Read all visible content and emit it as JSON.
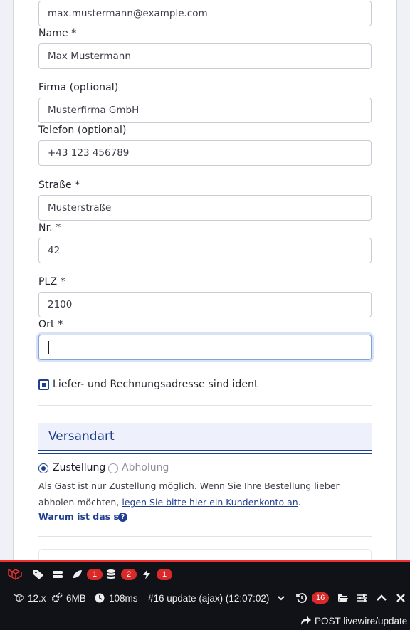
{
  "form": {
    "email_value": "max.mustermann@example.com",
    "name_label": "Name *",
    "name_value": "Max Mustermann",
    "company_label": "Firma (optional)",
    "company_value": "Musterfirma GmbH",
    "phone_label": "Telefon (optional)",
    "phone_value": "+43 123 456789",
    "street_label": "Straße *",
    "street_value": "Musterstraße",
    "number_label": "Nr. *",
    "number_value": "42",
    "zip_label": "PLZ *",
    "zip_value": "2100",
    "city_label": "Ort *",
    "city_value": "",
    "same_address_label": "Liefer- und Rechnungsadresse sind ident",
    "same_address_checked": true
  },
  "shipping": {
    "title": "Versandart",
    "option_delivery": "Zustellung",
    "option_pickup": "Abholung",
    "selected": "Zustellung",
    "info_text_1": "Als Gast ist nur Zustellung möglich. Wenn Sie Ihre Bestellung lieber abholen möchten,",
    "info_link": "legen Sie bitte hier ein Kundenkonto an",
    "info_text_2": ".",
    "why_label": "Warum ist das so",
    "why_icon": "?"
  },
  "debugbar": {
    "accent_color": "#f22d2d",
    "badge_color": "#d92a2a",
    "badges": {
      "queries": "1",
      "models": "2",
      "events": "1",
      "requests": "16"
    },
    "version": "12.x",
    "memory": "6MB",
    "time": "108ms",
    "request_select": "#16 update (ajax) (12:07:02)",
    "route": "POST livewire/update"
  }
}
